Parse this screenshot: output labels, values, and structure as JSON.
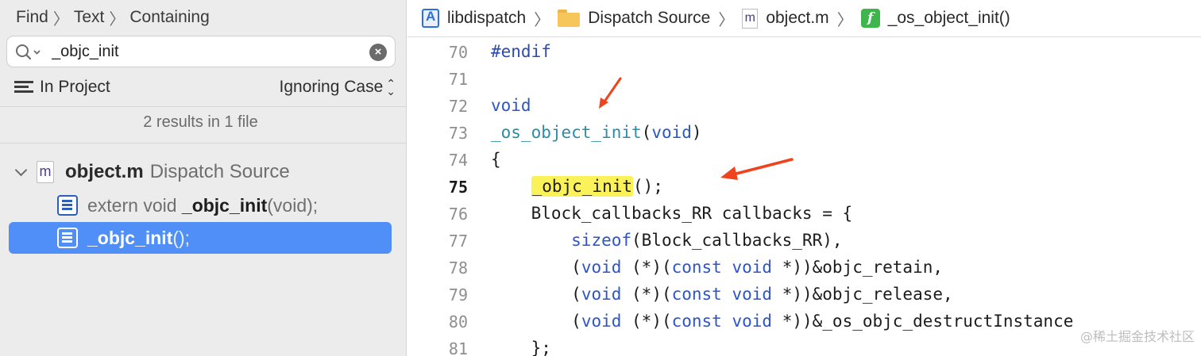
{
  "find_bar": {
    "mode": "Find",
    "type": "Text",
    "match": "Containing"
  },
  "search": {
    "value": "_objc_init",
    "placeholder": ""
  },
  "scope": {
    "label": "In Project",
    "case": "Ignoring Case"
  },
  "results_count": "2 results in 1 file",
  "results": {
    "file": {
      "name": "object.m",
      "group": "Dispatch Source"
    },
    "items": [
      {
        "prefix": "extern void ",
        "match": "_objc_init",
        "suffix": "(void);"
      },
      {
        "prefix": "",
        "match": "_objc_init",
        "suffix": "();"
      }
    ]
  },
  "jump_bar": {
    "project": "libdispatch",
    "group": "Dispatch Source",
    "file": "object.m",
    "symbol": "_os_object_init()"
  },
  "code": {
    "lines": [
      {
        "num": "70",
        "text": "#endif"
      },
      {
        "num": "71",
        "text": ""
      },
      {
        "num": "72",
        "text": "void"
      },
      {
        "num": "73",
        "fn": "_os_object_init",
        "args_open": "(",
        "args_kw": "void",
        "args_close": ")"
      },
      {
        "num": "74",
        "text": "{"
      },
      {
        "num": "75",
        "indent": "    ",
        "match": "_objc_init",
        "rest": "();"
      },
      {
        "num": "76",
        "text": "    Block_callbacks_RR callbacks = {"
      },
      {
        "num": "77",
        "indent": "        ",
        "kw": "sizeof",
        "rest": "(Block_callbacks_RR),"
      },
      {
        "num": "78",
        "indent": "        ",
        "a": "(",
        "k1": "void",
        "b": " (*)(",
        "k2": "const",
        "c": " ",
        "k3": "void",
        "rest": " *))&objc_retain,"
      },
      {
        "num": "79",
        "indent": "        ",
        "a": "(",
        "k1": "void",
        "b": " (*)(",
        "k2": "const",
        "c": " ",
        "k3": "void",
        "rest": " *))&objc_release,"
      },
      {
        "num": "80",
        "indent": "        ",
        "a": "(",
        "k1": "void",
        "b": " (*)(",
        "k2": "const",
        "c": " ",
        "k3": "void",
        "rest": " *))&_os_objc_destructInstance"
      },
      {
        "num": "81",
        "text": "    };"
      }
    ]
  },
  "watermark": "@稀土掘金技术社区",
  "colors": {
    "selection": "#4f8ff7",
    "highlight": "#fbf25a",
    "arrow": "#f0421c",
    "keyword": "#2d55c9"
  }
}
